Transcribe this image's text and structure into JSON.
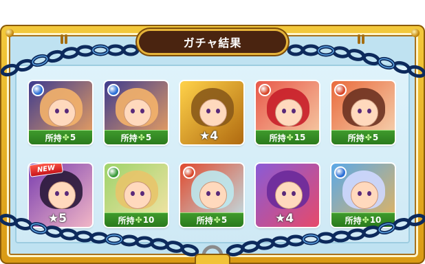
{
  "header": {
    "title": "ガチャ結果"
  },
  "results": [
    {
      "kind": "owned",
      "prefix": "所持",
      "count": "5",
      "element": "water",
      "orb_color": "#2c6fd6",
      "art": [
        "#3e3b8f",
        "#f2a55e"
      ],
      "hair": "#f4b26a"
    },
    {
      "kind": "owned",
      "prefix": "所持",
      "count": "5",
      "element": "water",
      "orb_color": "#2c6fd6",
      "art": [
        "#3e3b8f",
        "#f2a55e"
      ],
      "hair": "#f4b26a"
    },
    {
      "kind": "star",
      "label": "★4",
      "art": [
        "#ffd24a",
        "#b06a10"
      ],
      "hair": "#8a5a1a"
    },
    {
      "kind": "owned",
      "prefix": "所持",
      "count": "15",
      "element": "fire",
      "orb_color": "#d8472a",
      "art": [
        "#e8584a",
        "#f6d0a8"
      ],
      "hair": "#c81f2a"
    },
    {
      "kind": "owned",
      "prefix": "所持",
      "count": "5",
      "element": "fire",
      "orb_color": "#d8472a",
      "art": [
        "#e96a3c",
        "#f6d8b6"
      ],
      "hair": "#6b3221"
    },
    {
      "kind": "star",
      "label": "★5",
      "new_label": "NEW",
      "art": [
        "#7a3fb0",
        "#f1b6c6"
      ],
      "hair": "#2a1a3a"
    },
    {
      "kind": "owned",
      "prefix": "所持",
      "count": "10",
      "element": "wood",
      "orb_color": "#3a9b3a",
      "art": [
        "#9ed36b",
        "#f7e4a8"
      ],
      "hair": "#e8c46a"
    },
    {
      "kind": "owned",
      "prefix": "所持",
      "count": "5",
      "element": "fire",
      "orb_color": "#d8472a",
      "art": [
        "#e04a2e",
        "#bfe6ee"
      ],
      "hair": "#bde9ef"
    },
    {
      "kind": "star",
      "label": "★4",
      "art": [
        "#8a5bd6",
        "#e64a6a"
      ],
      "hair": "#6a2a9a"
    },
    {
      "kind": "owned",
      "prefix": "所持",
      "count": "10",
      "element": "water",
      "orb_color": "#2c6fd6",
      "art": [
        "#5aa8e8",
        "#e8b45a"
      ],
      "hair": "#cfd8ff"
    }
  ]
}
